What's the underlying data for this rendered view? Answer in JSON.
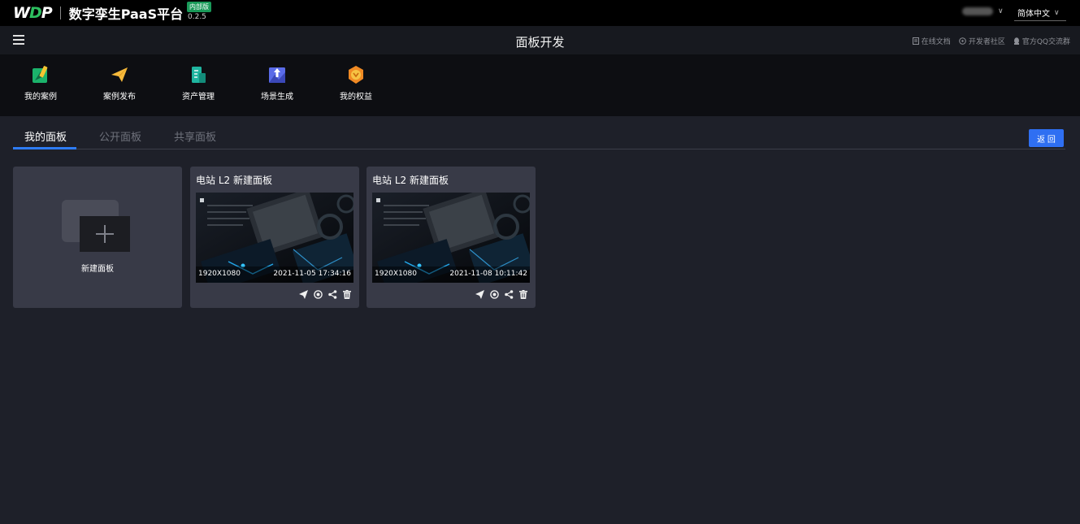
{
  "header": {
    "logo": "WDP",
    "brand": "数字孪生PaaS平台",
    "badge": "内部版",
    "version": "0.2.5",
    "language": "简体中文"
  },
  "titlebar": {
    "title": "面板开发",
    "links": [
      "在线文档",
      "开发者社区",
      "官方QQ交流群"
    ]
  },
  "toolbar": {
    "items": [
      {
        "label": "我的案例",
        "icon": "case-icon"
      },
      {
        "label": "案例发布",
        "icon": "paper-plane-icon"
      },
      {
        "label": "资产管理",
        "icon": "asset-icon"
      },
      {
        "label": "场景生成",
        "icon": "scene-upload-icon"
      },
      {
        "label": "我的权益",
        "icon": "badge-icon"
      }
    ]
  },
  "tabs": [
    {
      "label": "我的面板",
      "active": true
    },
    {
      "label": "公开面板",
      "active": false
    },
    {
      "label": "共享面板",
      "active": false
    }
  ],
  "back_button": "返 回",
  "new_panel_label": "新建面板",
  "panels": [
    {
      "title": "电站 L2 新建面板",
      "resolution": "1920X1080",
      "time": "2021-11-05 17:34:16"
    },
    {
      "title": "电站 L2 新建面板",
      "resolution": "1920X1080",
      "time": "2021-11-08 10:11:42"
    }
  ],
  "colors": {
    "accent": "#2f6ff2",
    "tab_underline": "#2e7cf6",
    "card_bg": "#383a47",
    "page_bg": "#1e2029"
  }
}
